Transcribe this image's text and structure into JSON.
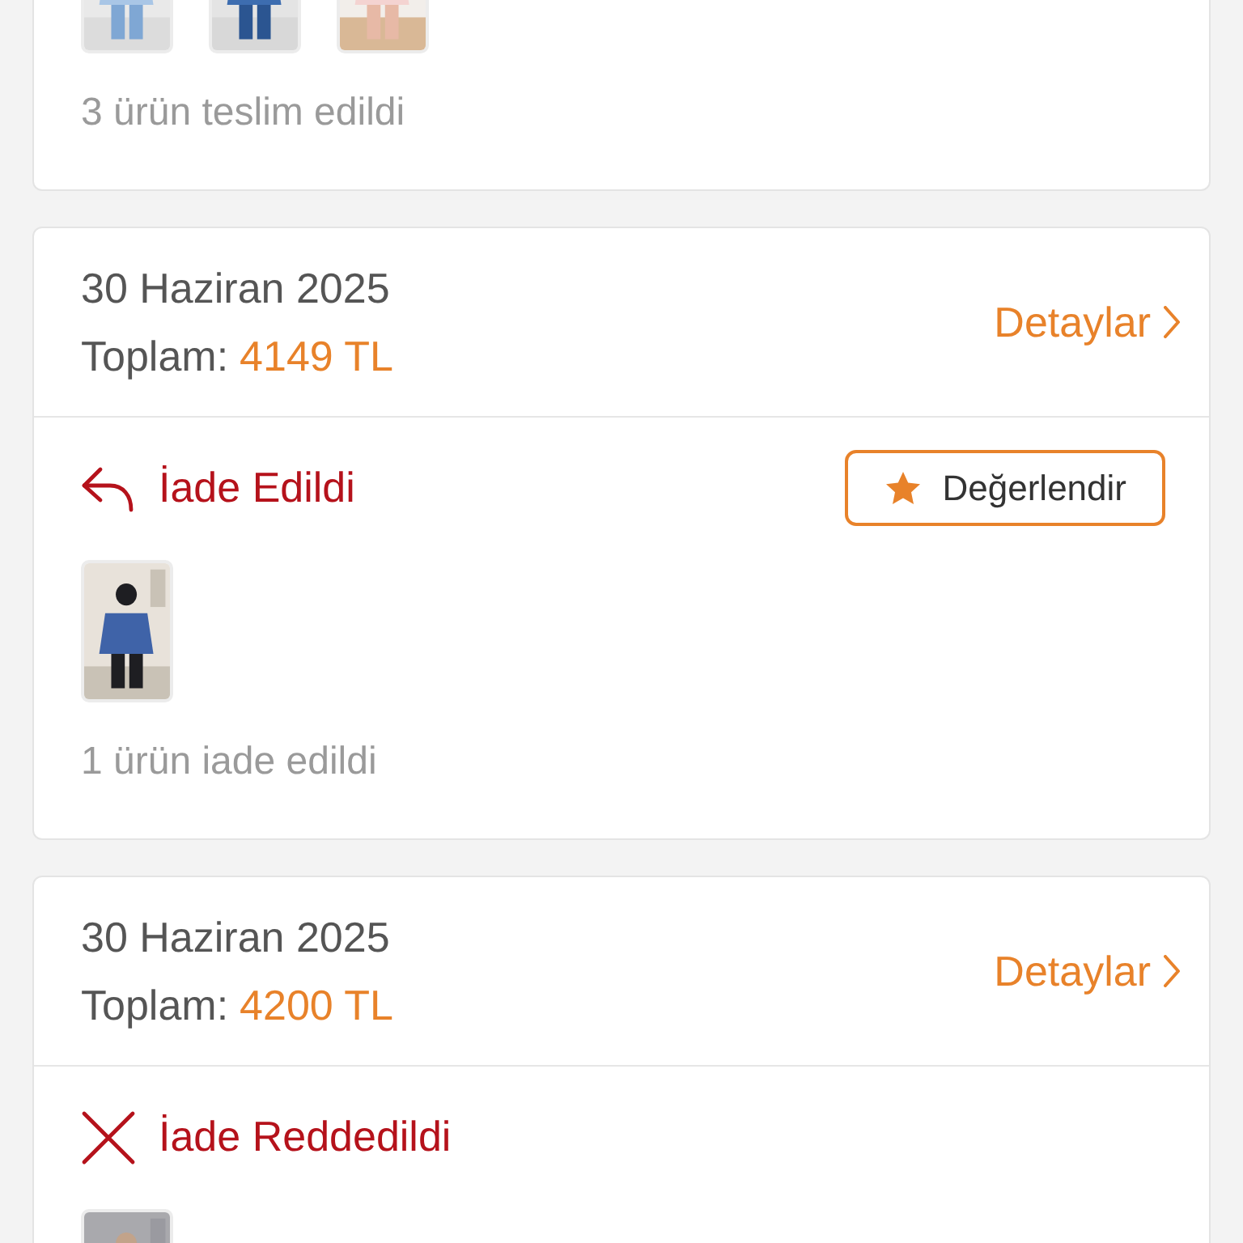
{
  "orders": [
    {
      "summary": "3 ürün teslim edildi"
    },
    {
      "date": "30 Haziran 2025",
      "total_label": "Toplam:",
      "total": "4149 TL",
      "details": "Detaylar",
      "status": {
        "kind": "returned",
        "label": "İade Edildi"
      },
      "rate_button": {
        "label": "Değerlendir"
      },
      "summary": "1 ürün iade edildi"
    },
    {
      "date": "30 Haziran 2025",
      "total_label": "Toplam:",
      "total": "4200 TL",
      "details": "Detaylar",
      "status": {
        "kind": "rejected",
        "label": "İade Reddedildi"
      }
    }
  ]
}
